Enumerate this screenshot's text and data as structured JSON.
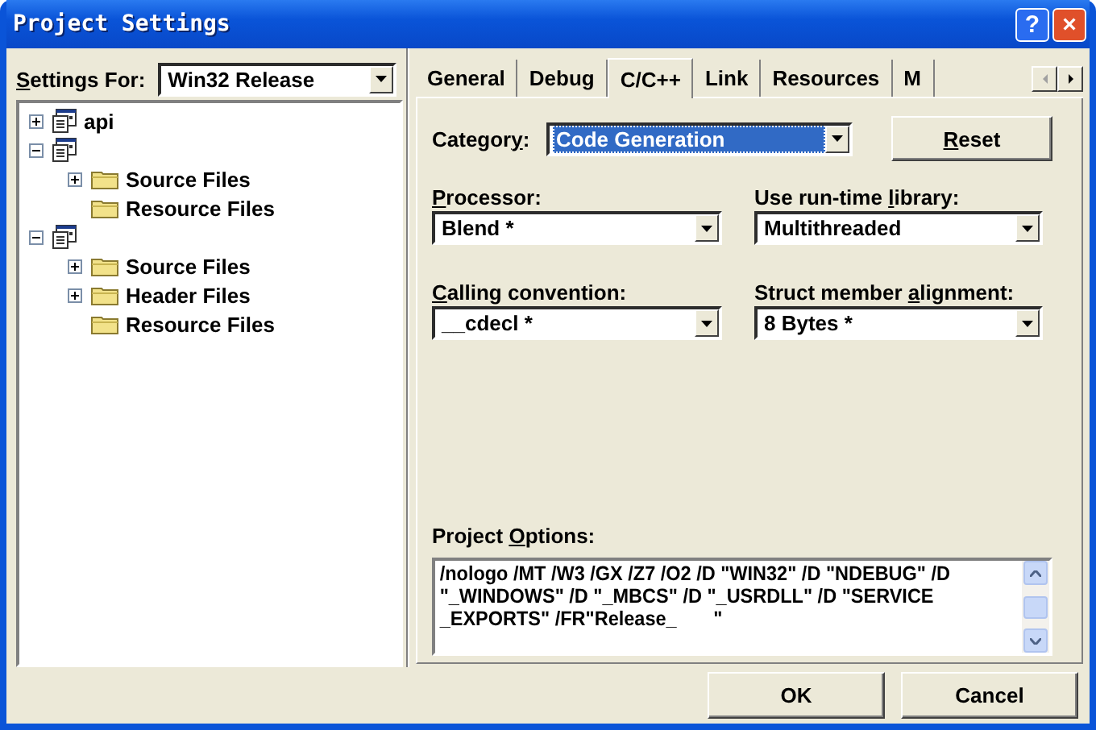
{
  "window": {
    "title": "Project Settings",
    "buttons": [
      "?",
      "×"
    ]
  },
  "settings_for": {
    "access_key": "S",
    "label_post": "ettings For:",
    "value": "Win32 Release"
  },
  "tree": [
    {
      "label": "api",
      "kind": "project",
      "expanded": false
    },
    {
      "kind": "project",
      "expanded": true,
      "children": [
        {
          "label": "Source Files",
          "kind": "folder",
          "expanded": false
        },
        {
          "label": "Resource Files",
          "kind": "folder"
        }
      ]
    },
    {
      "kind": "project",
      "expanded": true,
      "children": [
        {
          "label": "Source Files",
          "kind": "folder",
          "expanded": false
        },
        {
          "label": "Header Files",
          "kind": "folder",
          "expanded": false
        },
        {
          "label": "Resource Files",
          "kind": "folder"
        }
      ]
    }
  ],
  "tabs": [
    {
      "label": "General",
      "selected": false
    },
    {
      "label": "Debug",
      "selected": false
    },
    {
      "label": "C/C++",
      "selected": true
    },
    {
      "label": "Link",
      "selected": false
    },
    {
      "label": "Resources",
      "selected": false
    },
    {
      "label": "M",
      "selected": false
    }
  ],
  "category": {
    "label_pre": "Categor",
    "access_key": "y",
    "label_post": ":",
    "value": "Code Generation",
    "focused": true
  },
  "reset_button": {
    "access_key": "R",
    "label_post": "eset"
  },
  "fields": [
    {
      "access_key": "P",
      "label_post": "rocessor:",
      "value": "Blend *"
    },
    {
      "label_pre": "Use run-time ",
      "access_key": "l",
      "label_post": "ibrary:",
      "value": "Multithreaded"
    },
    {
      "access_key": "C",
      "label_post": "alling convention:",
      "value": "__cdecl *"
    },
    {
      "label_pre": "Struct member ",
      "access_key": "a",
      "label_post": "lignment:",
      "value": "8 Bytes *"
    }
  ],
  "project_options": {
    "label_pre": "Project ",
    "access_key": "O",
    "label_post": "ptions:",
    "value": "/nologo /MT /W3 /GX /Z7 /O2 /D \"WIN32\" /D \"NDEBUG\" /D \"_WINDOWS\" /D \"_MBCS\" /D \"_USRDLL\" /D \"SERVICE       _EXPORTS\" /FR\"Release_       \""
  },
  "buttons": [
    "OK",
    "Cancel"
  ]
}
